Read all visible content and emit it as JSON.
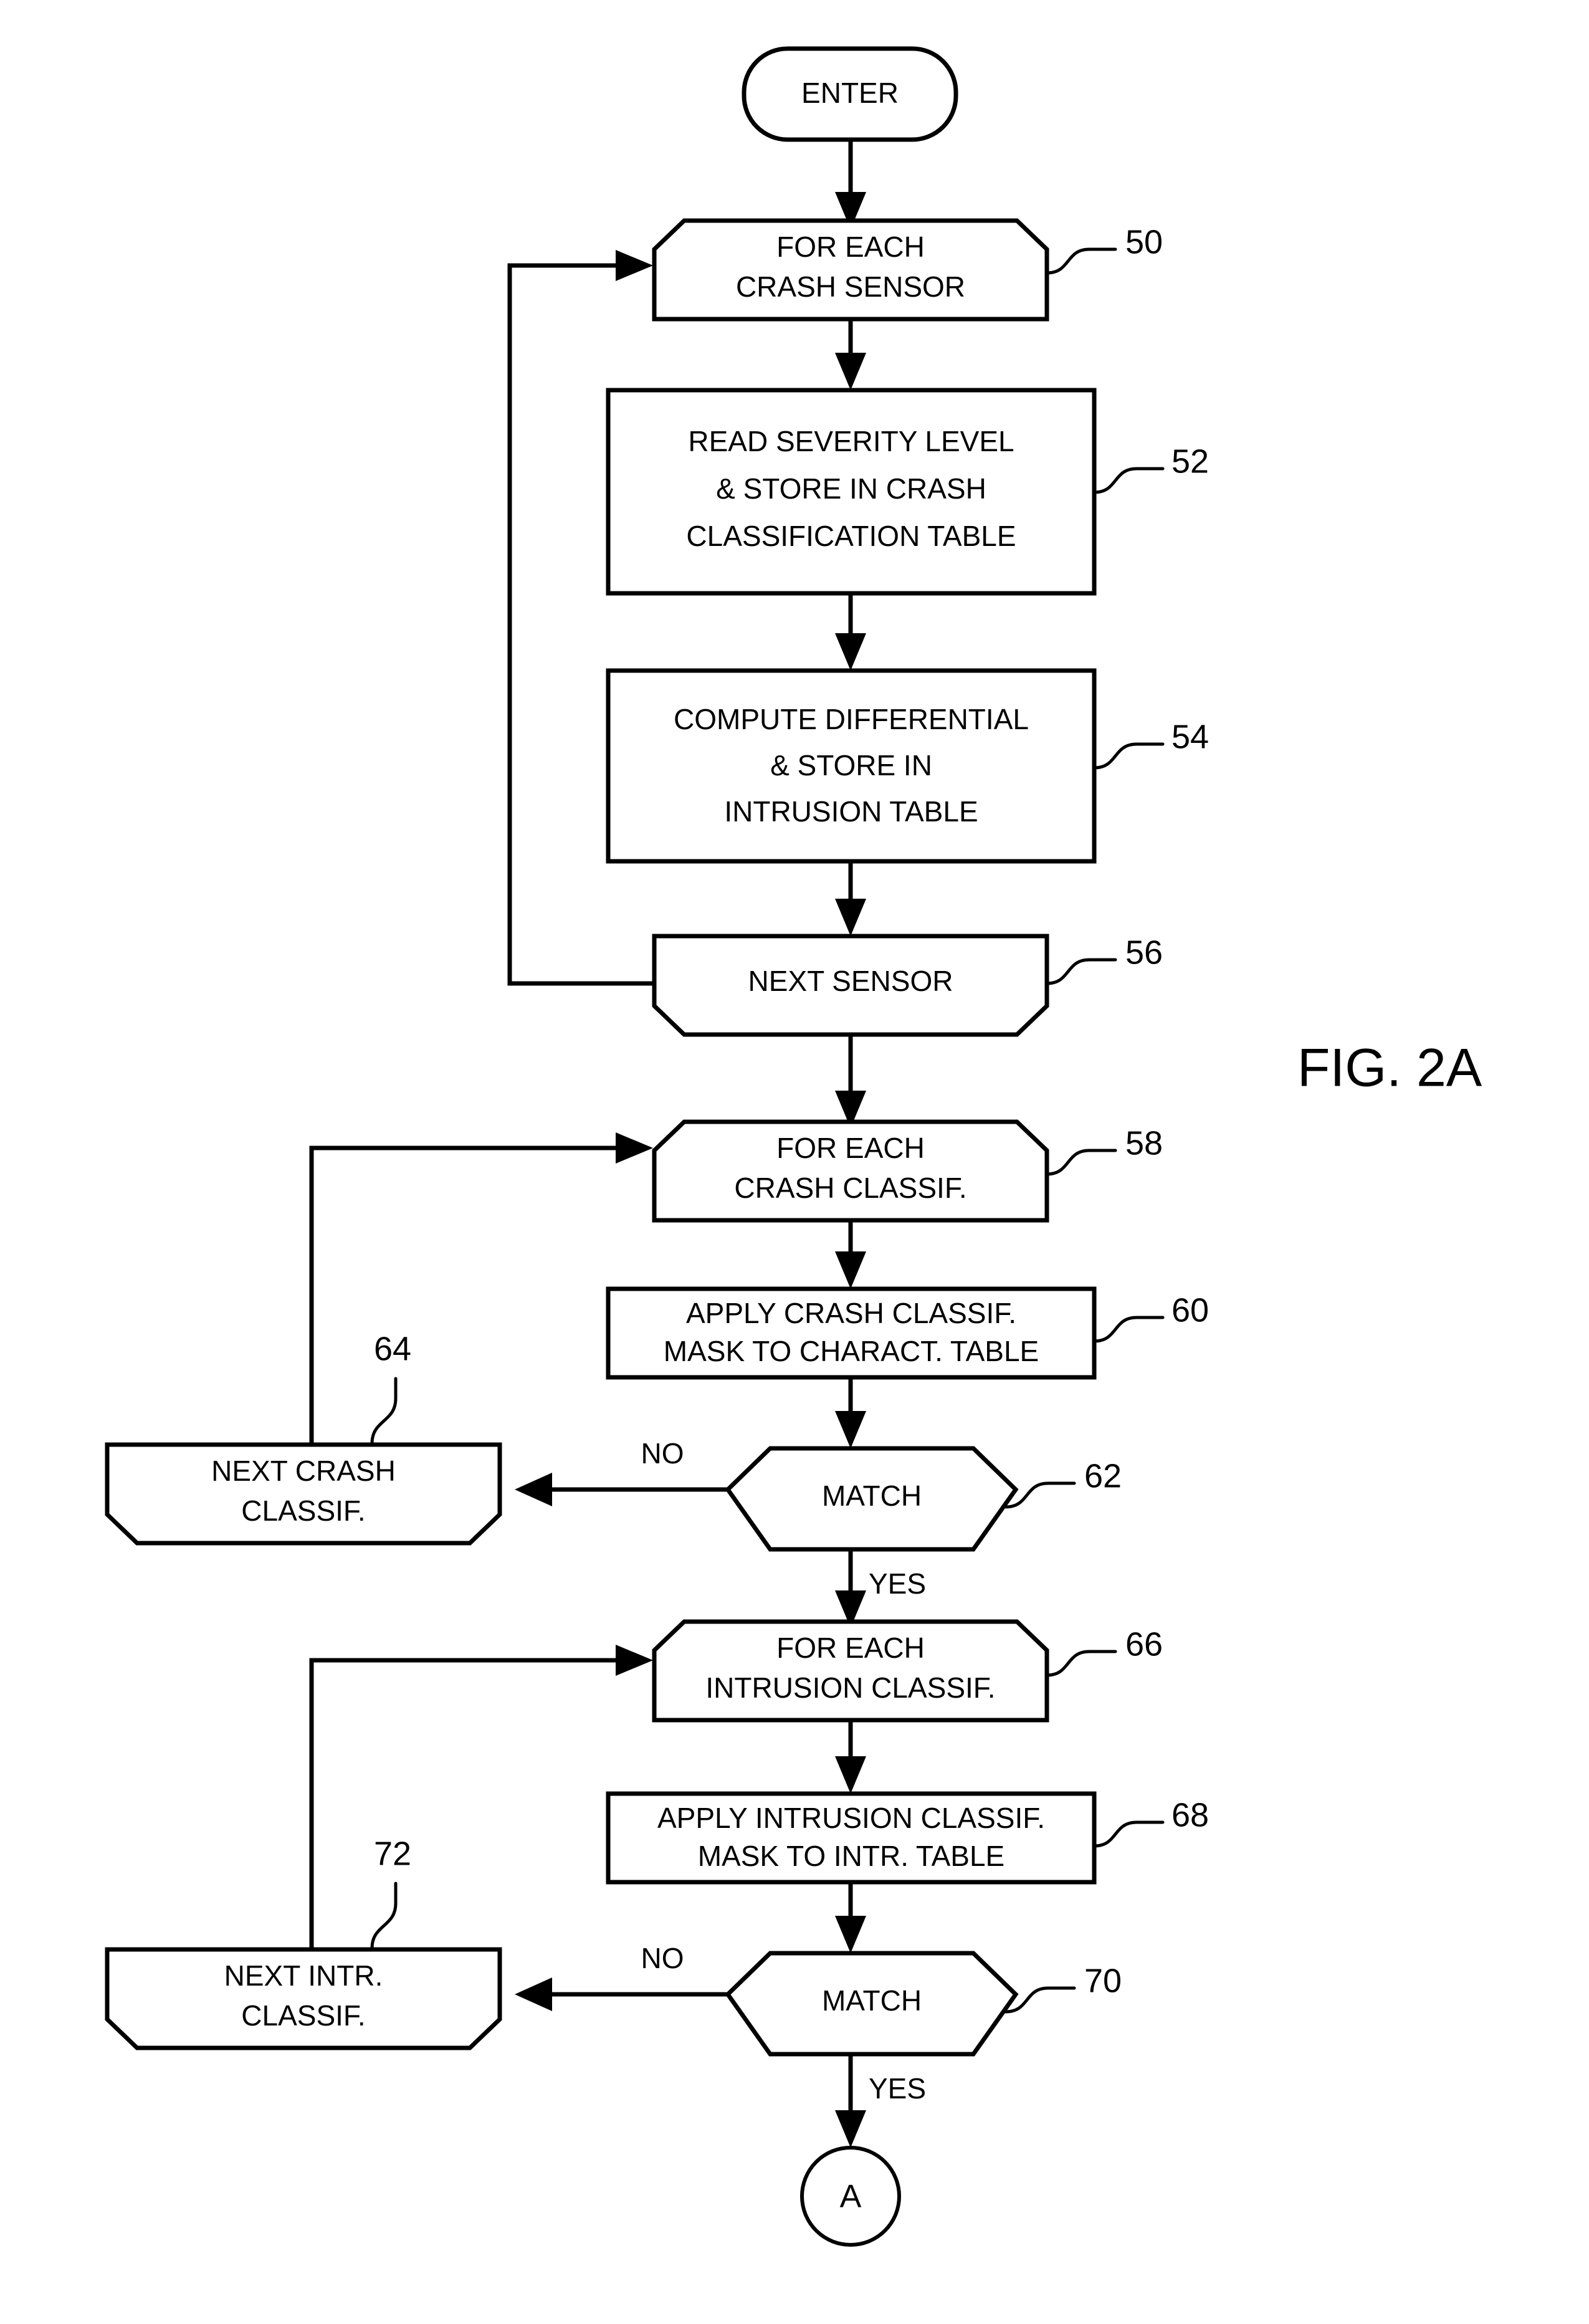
{
  "figure": {
    "label": "FIG. 2A",
    "type": "patent-flowchart"
  },
  "nodes": {
    "enter": {
      "label": "ENTER",
      "shape": "terminator",
      "ref": ""
    },
    "n50": {
      "line1": "FOR EACH",
      "line2": "CRASH SENSOR",
      "shape": "loop-start",
      "ref": "50"
    },
    "n52": {
      "line1": "READ SEVERITY LEVEL",
      "line2": "& STORE IN CRASH",
      "line3": "CLASSIFICATION TABLE",
      "shape": "process",
      "ref": "52"
    },
    "n54": {
      "line1": "COMPUTE DIFFERENTIAL",
      "line2": "& STORE IN",
      "line3": "INTRUSION TABLE",
      "shape": "process",
      "ref": "54"
    },
    "n56": {
      "line1": "NEXT SENSOR",
      "shape": "loop-end",
      "ref": "56"
    },
    "n58": {
      "line1": "FOR EACH",
      "line2": "CRASH CLASSIF.",
      "shape": "loop-start",
      "ref": "58"
    },
    "n60": {
      "line1": "APPLY CRASH CLASSIF.",
      "line2": "MASK TO CHARACT. TABLE",
      "shape": "process",
      "ref": "60"
    },
    "n62": {
      "line1": "MATCH",
      "shape": "decision",
      "ref": "62"
    },
    "n64": {
      "line1": "NEXT CRASH",
      "line2": "CLASSIF.",
      "shape": "loop-end",
      "ref": "64"
    },
    "n66": {
      "line1": "FOR EACH",
      "line2": "INTRUSION CLASSIF.",
      "shape": "loop-start",
      "ref": "66"
    },
    "n68": {
      "line1": "APPLY INTRUSION CLASSIF.",
      "line2": "MASK TO INTR. TABLE",
      "shape": "process",
      "ref": "68"
    },
    "n70": {
      "line1": "MATCH",
      "shape": "decision",
      "ref": "70"
    },
    "n72": {
      "line1": "NEXT INTR.",
      "line2": "CLASSIF.",
      "shape": "loop-end",
      "ref": "72"
    },
    "connA": {
      "label": "A",
      "shape": "off-page-connector",
      "ref": ""
    }
  },
  "branch_labels": {
    "no_62": "NO",
    "yes_62": "YES",
    "no_70": "NO",
    "yes_70": "YES"
  }
}
